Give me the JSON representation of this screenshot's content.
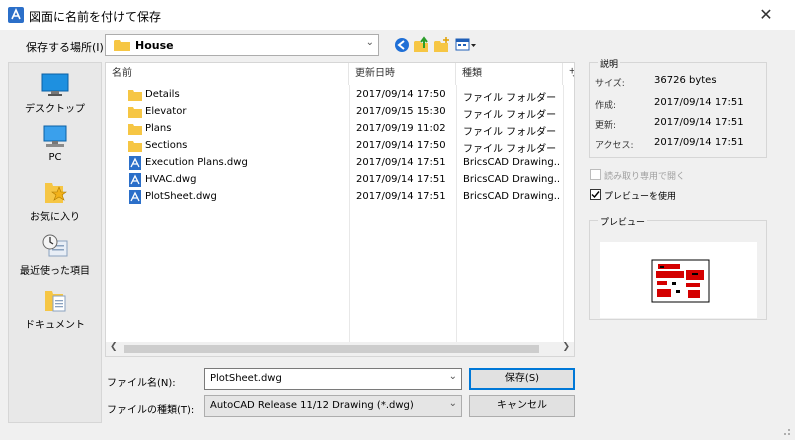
{
  "window": {
    "title": "図面に名前を付けて保存",
    "close_glyph": "✕"
  },
  "lookin": {
    "label": "保存する場所(I):",
    "value": "House"
  },
  "toolbar": {
    "icons": [
      "back-icon",
      "up-folder-icon",
      "new-folder-icon",
      "views-menu-icon"
    ]
  },
  "places": [
    {
      "label": "デスクトップ",
      "icon": "desktop-icon"
    },
    {
      "label": "PC",
      "icon": "pc-icon"
    },
    {
      "label": "お気に入り",
      "icon": "favorites-icon"
    },
    {
      "label": "最近使った項目",
      "icon": "recent-icon"
    },
    {
      "label": "ドキュメント",
      "icon": "documents-icon"
    }
  ],
  "file_list": {
    "columns": [
      "名前",
      "更新日時",
      "種類",
      "サ"
    ],
    "rows": [
      {
        "name": "Details",
        "modified": "2017/09/14 17:50",
        "type": "ファイル フォルダー",
        "icon": "folder-icon"
      },
      {
        "name": "Elevator",
        "modified": "2017/09/15 15:30",
        "type": "ファイル フォルダー",
        "icon": "folder-icon"
      },
      {
        "name": "Plans",
        "modified": "2017/09/19 11:02",
        "type": "ファイル フォルダー",
        "icon": "folder-icon"
      },
      {
        "name": "Sections",
        "modified": "2017/09/14 17:50",
        "type": "ファイル フォルダー",
        "icon": "folder-icon"
      },
      {
        "name": "Execution Plans.dwg",
        "modified": "2017/09/14 17:51",
        "type": "BricsCAD Drawing...",
        "icon": "dwg-file-icon"
      },
      {
        "name": "HVAC.dwg",
        "modified": "2017/09/14 17:51",
        "type": "BricsCAD Drawing...",
        "icon": "dwg-file-icon"
      },
      {
        "name": "PlotSheet.dwg",
        "modified": "2017/09/14 17:51",
        "type": "BricsCAD Drawing...",
        "icon": "dwg-file-icon"
      }
    ]
  },
  "filename": {
    "label": "ファイル名(N):",
    "value": "PlotSheet.dwg"
  },
  "filetype": {
    "label": "ファイルの種類(T):",
    "value": "AutoCAD Release 11/12 Drawing (*.dwg)"
  },
  "buttons": {
    "save": "保存(S)",
    "cancel": "キャンセル"
  },
  "properties": {
    "title": "説明",
    "size_label": "サイズ:",
    "size_value": "36726 bytes",
    "created_label": "作成:",
    "created_value": "2017/09/14 17:51",
    "modified_label": "更新:",
    "modified_value": "2017/09/14 17:51",
    "accessed_label": "アクセス:",
    "accessed_value": "2017/09/14 17:51"
  },
  "options": {
    "readonly_label": "読み取り専用で開く",
    "readonly_checked": false,
    "readonly_enabled": false,
    "preview_label": "プレビューを使用",
    "preview_checked": true
  },
  "preview": {
    "title": "プレビュー"
  },
  "colors": {
    "accent": "#0078d7",
    "folder": "#f6c644",
    "dwg_icon": "#2b6fc9",
    "preview_red": "#d40000"
  }
}
